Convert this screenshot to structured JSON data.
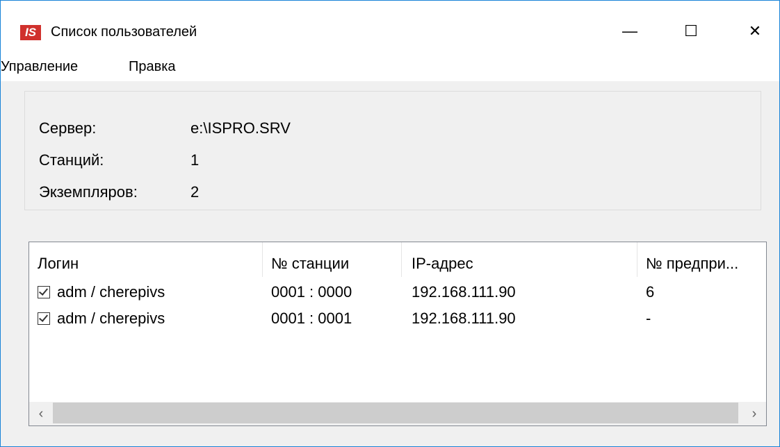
{
  "window": {
    "title": "Список пользователей",
    "icon_text": "IS",
    "controls": {
      "minimize": "—",
      "maximize": "☐",
      "close": "✕"
    }
  },
  "menu": {
    "items": [
      "Управление",
      "Правка"
    ]
  },
  "info": {
    "server_label": "Сервер:",
    "server_value": "e:\\ISPRO.SRV",
    "stations_label": "Станций:",
    "stations_value": "1",
    "instances_label": "Экземпляров:",
    "instances_value": "2"
  },
  "table": {
    "columns": [
      "Логин",
      "№ станции",
      "IP-адрес",
      "№ предпри..."
    ],
    "rows": [
      {
        "checked": true,
        "login": "adm / cherepivs",
        "station": "0001 : 0000",
        "ip": "192.168.111.90",
        "enterprise": "6"
      },
      {
        "checked": true,
        "login": "adm / cherepivs",
        "station": "0001 : 0001",
        "ip": "192.168.111.90",
        "enterprise": "-"
      }
    ]
  },
  "scrollbar": {
    "left_arrow": "‹",
    "right_arrow": "›"
  },
  "colors": {
    "accent_border": "#1883d7",
    "app_icon_bg": "#d0312d"
  }
}
